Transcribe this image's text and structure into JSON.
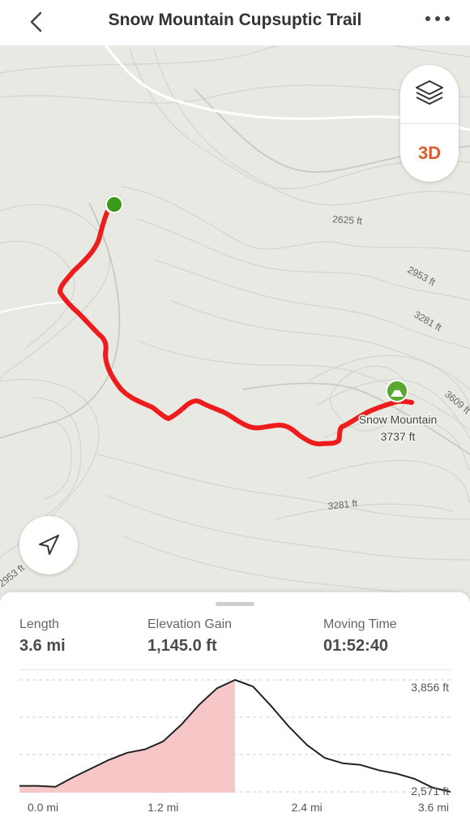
{
  "header": {
    "title": "Snow Mountain Cupsuptic Trail"
  },
  "map": {
    "contour_labels": [
      "2625 ft",
      "2953 ft",
      "3281 ft",
      "3609 ft",
      "3281 ft",
      "2953 ft"
    ],
    "summit_name": "Snow Mountain",
    "summit_elevation": "3737 ft",
    "layer_button_label": "3D",
    "colors": {
      "route": "#ee1c1c",
      "start": "#3a9a1a",
      "summit": "#59a82f",
      "accent": "#e05a2b"
    },
    "icons": [
      "back-arrow-icon",
      "more-dots-icon",
      "layers-icon",
      "navigation-arrow-icon",
      "summit-mountain-icon"
    ]
  },
  "stats": [
    {
      "label": "Length",
      "value": "3.6 mi"
    },
    {
      "label": "Elevation Gain",
      "value": "1,145.0 ft"
    },
    {
      "label": "Moving Time",
      "value": "01:52:40"
    }
  ],
  "chart_data": {
    "type": "area",
    "xlabel": "",
    "ylabel": "",
    "x_ticks": [
      "0.0 mi",
      "1.2 mi",
      "2.4 mi",
      "3.6 mi"
    ],
    "y_ticks": [
      "3,856 ft",
      "2,571 ft"
    ],
    "xlim": [
      0,
      3.6
    ],
    "ylim": [
      2571,
      3856
    ],
    "progress_x": 1.8,
    "series": [
      {
        "x": [
          0.0,
          0.15,
          0.3,
          0.45,
          0.6,
          0.75,
          0.9,
          1.05,
          1.2,
          1.35,
          1.5,
          1.65,
          1.8,
          1.95,
          2.1,
          2.25,
          2.4,
          2.55,
          2.7,
          2.85,
          3.0,
          3.15,
          3.3,
          3.45,
          3.6
        ],
        "y": [
          2640,
          2640,
          2630,
          2740,
          2840,
          2940,
          3020,
          3060,
          3150,
          3340,
          3570,
          3760,
          3856,
          3780,
          3560,
          3320,
          3110,
          2960,
          2900,
          2880,
          2820,
          2780,
          2720,
          2620,
          2571
        ]
      }
    ]
  }
}
